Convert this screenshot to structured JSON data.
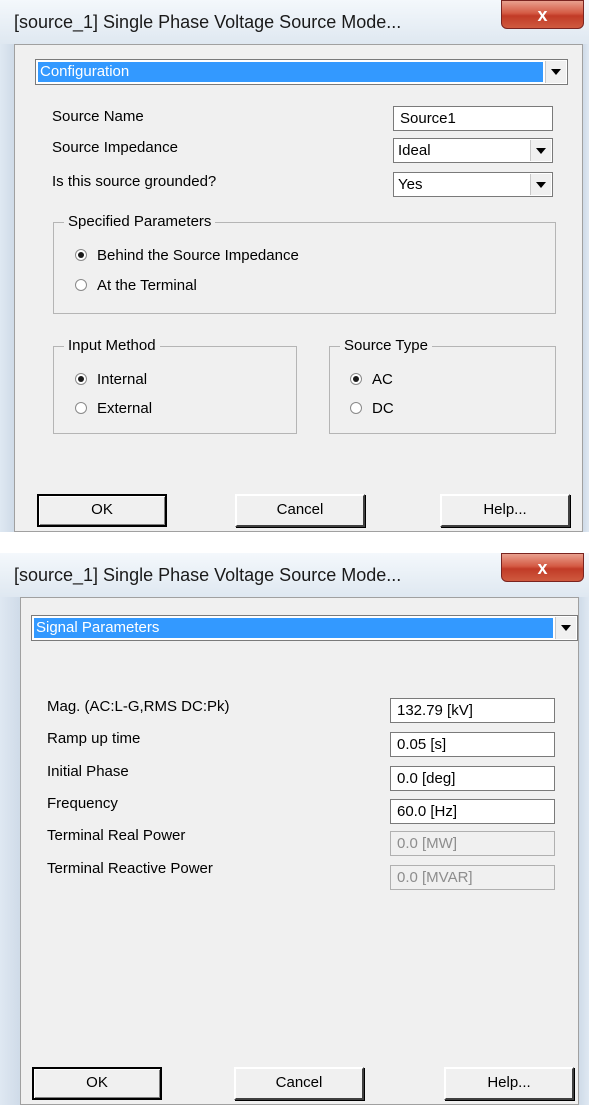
{
  "dialog1": {
    "title": "[source_1] Single Phase Voltage Source Mode...",
    "close_glyph": "x",
    "page_selector": "Configuration",
    "fields": {
      "source_name_label": "Source Name",
      "source_name_value": "Source1",
      "impedance_label": "Source Impedance",
      "impedance_value": "Ideal",
      "grounded_label": "Is this source grounded?",
      "grounded_value": "Yes"
    },
    "specified_parameters": {
      "legend": "Specified Parameters",
      "options": [
        "Behind the Source Impedance",
        "At the Terminal"
      ],
      "selected": 0
    },
    "input_method": {
      "legend": "Input Method",
      "options": [
        "Internal",
        "External"
      ],
      "selected": 0
    },
    "source_type": {
      "legend": "Source Type",
      "options": [
        "AC",
        "DC"
      ],
      "selected": 0
    },
    "buttons": {
      "ok": "OK",
      "cancel": "Cancel",
      "help": "Help..."
    }
  },
  "dialog2": {
    "title": "[source_1] Single Phase Voltage Source Mode...",
    "close_glyph": "x",
    "page_selector": "Signal Parameters",
    "params": [
      {
        "label": "Mag. (AC:L-G,RMS DC:Pk)",
        "value": "132.79 [kV]",
        "enabled": true
      },
      {
        "label": "Ramp up time",
        "value": "0.05 [s]",
        "enabled": true
      },
      {
        "label": "Initial Phase",
        "value": "0.0 [deg]",
        "enabled": true
      },
      {
        "label": "Frequency",
        "value": "60.0 [Hz]",
        "enabled": true
      },
      {
        "label": "Terminal Real Power",
        "value": "0.0 [MW]",
        "enabled": false
      },
      {
        "label": "Terminal Reactive Power",
        "value": "0.0 [MVAR]",
        "enabled": false
      }
    ],
    "buttons": {
      "ok": "OK",
      "cancel": "Cancel",
      "help": "Help..."
    }
  }
}
